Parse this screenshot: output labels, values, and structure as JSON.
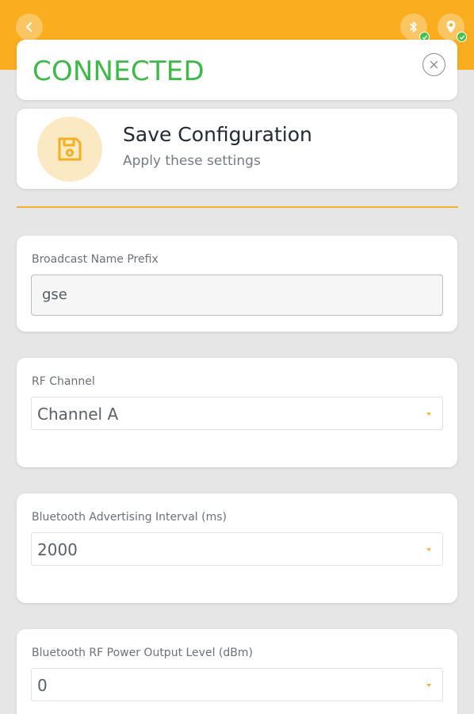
{
  "header": {
    "back_icon": "chevron-left-icon",
    "status_icons": [
      "bluetooth-icon",
      "location-icon"
    ],
    "accent_color": "#f9ad1f"
  },
  "status": {
    "text": "CONNECTED",
    "color": "#3fb84a",
    "close_icon": "close-icon"
  },
  "save": {
    "title": "Save Configuration",
    "subtitle": "Apply these settings",
    "icon": "save-icon"
  },
  "fields": {
    "broadcast_prefix": {
      "label": "Broadcast Name Prefix",
      "value": "gse"
    },
    "rf_channel": {
      "label": "RF Channel",
      "value": "Channel A"
    },
    "adv_interval": {
      "label": "Bluetooth Advertising Interval (ms)",
      "value": "2000"
    },
    "rf_power": {
      "label": "Bluetooth RF Power Output Level (dBm)",
      "value": "0"
    }
  }
}
